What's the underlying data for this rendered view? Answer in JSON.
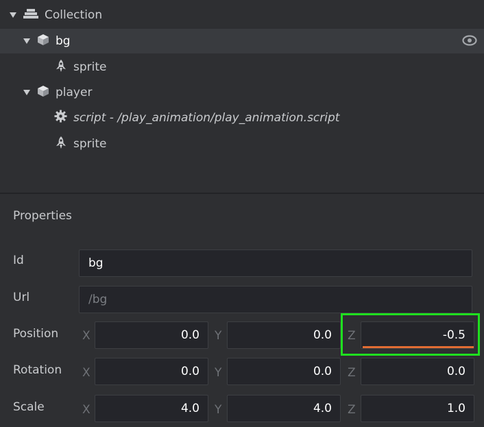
{
  "outline": {
    "items": [
      {
        "label": "Collection",
        "icon": "collection-icon",
        "expanded": true
      },
      {
        "label": "bg",
        "icon": "game-object-icon",
        "expanded": true,
        "selected": true
      },
      {
        "label": "sprite",
        "icon": "sprite-icon"
      },
      {
        "label": "player",
        "icon": "game-object-icon",
        "expanded": true
      },
      {
        "label": "script - /play_animation/play_animation.script",
        "icon": "script-gear-icon"
      },
      {
        "label": "sprite",
        "icon": "sprite-icon"
      }
    ],
    "visibility_icon": "eye-icon"
  },
  "properties": {
    "title": "Properties",
    "id_label": "Id",
    "id_value": "bg",
    "url_label": "Url",
    "url_value": "/bg",
    "position_label": "Position",
    "rotation_label": "Rotation",
    "scale_label": "Scale",
    "axis_x": "X",
    "axis_y": "Y",
    "axis_z": "Z",
    "position": {
      "x": "0.0",
      "y": "0.0",
      "z": "-0.5"
    },
    "rotation": {
      "x": "0.0",
      "y": "0.0",
      "z": "0.0"
    },
    "scale": {
      "x": "4.0",
      "y": "4.0",
      "z": "1.0"
    }
  },
  "colors": {
    "highlight": "#1fe01f",
    "edited_underline": "#e26d33"
  }
}
